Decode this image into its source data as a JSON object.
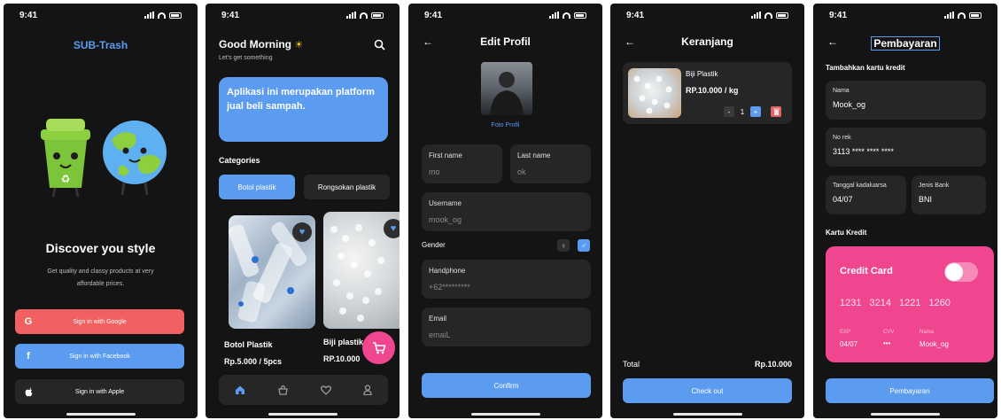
{
  "status_time": "9:41",
  "screen1": {
    "brand": "SUB-Trash",
    "title": "Discover you style",
    "subtitle_line1": "Get quality and classy products at very",
    "subtitle_line2": "affordable prices.",
    "google_btn": "Sign in with Google",
    "facebook_btn": "Sign in with Facebook",
    "apple_btn": "Sign in with Apple",
    "colors": {
      "google": "#f26161",
      "facebook": "#5b9bf0",
      "apple": "#262626"
    }
  },
  "screen2": {
    "greeting": "Good Morning",
    "greeting_sub": "Let's get something",
    "banner": "Aplikasi ini merupakan platform jual beli sampah.",
    "categories_title": "Categories",
    "category_1": "Botol plastik",
    "category_2": "Rongsokan plastik",
    "product_1_name": "Botol Plastik",
    "product_1_price": "Rp.5.000 / 5pcs",
    "product_2_name": "Biji plastik",
    "product_2_price": "RP.10.000",
    "nav_icons": [
      "home-icon",
      "bag-icon",
      "heart-icon",
      "user-icon"
    ]
  },
  "screen3": {
    "title": "Edit Profil",
    "photo_label": "Foto Profil",
    "first_name_label": "First name",
    "first_name_value": "mo",
    "last_name_label": "Last name",
    "last_name_value": "ok",
    "username_label": "Username",
    "username_value": "mook_og",
    "gender_label": "Gender",
    "handphone_label": "Handphone",
    "handphone_value": "+62*********",
    "email_label": "Email",
    "email_value": "emaiL",
    "confirm_btn": "Confirm"
  },
  "screen4": {
    "title": "Keranjang",
    "item_name": "Biji Plastik",
    "item_price": "RP.10.000 / kg",
    "qty_minus": "-",
    "qty": "1",
    "qty_plus": "+",
    "total_label": "Total",
    "total_value": "Rp.10.000",
    "checkout_btn": "Check out"
  },
  "screen5": {
    "title": "Pembayaran",
    "add_card_title": "Tambahkan kartu kredit",
    "name_label": "Nama",
    "name_value": "Mook_og",
    "norek_label": "No rek",
    "norek_value": "3113 **** **** ****",
    "expiry_label": "Tanggal kadaluarsa",
    "expiry_value": "04/07",
    "bank_label": "Jenis Bank",
    "bank_value": "BNI",
    "card_section": "Kartu Kredit",
    "card_title": "Credit Card",
    "card_number": [
      "1231",
      "3214",
      "1221",
      "1260"
    ],
    "exp_label": "EXP",
    "exp_value": "04/07",
    "cvv_label": "CVV",
    "cvv_value": "•••",
    "nama_label": "Nama",
    "nama_value": "Mook_og",
    "pay_btn": "Pembayaran",
    "colors": {
      "card": "#f0458f"
    }
  }
}
